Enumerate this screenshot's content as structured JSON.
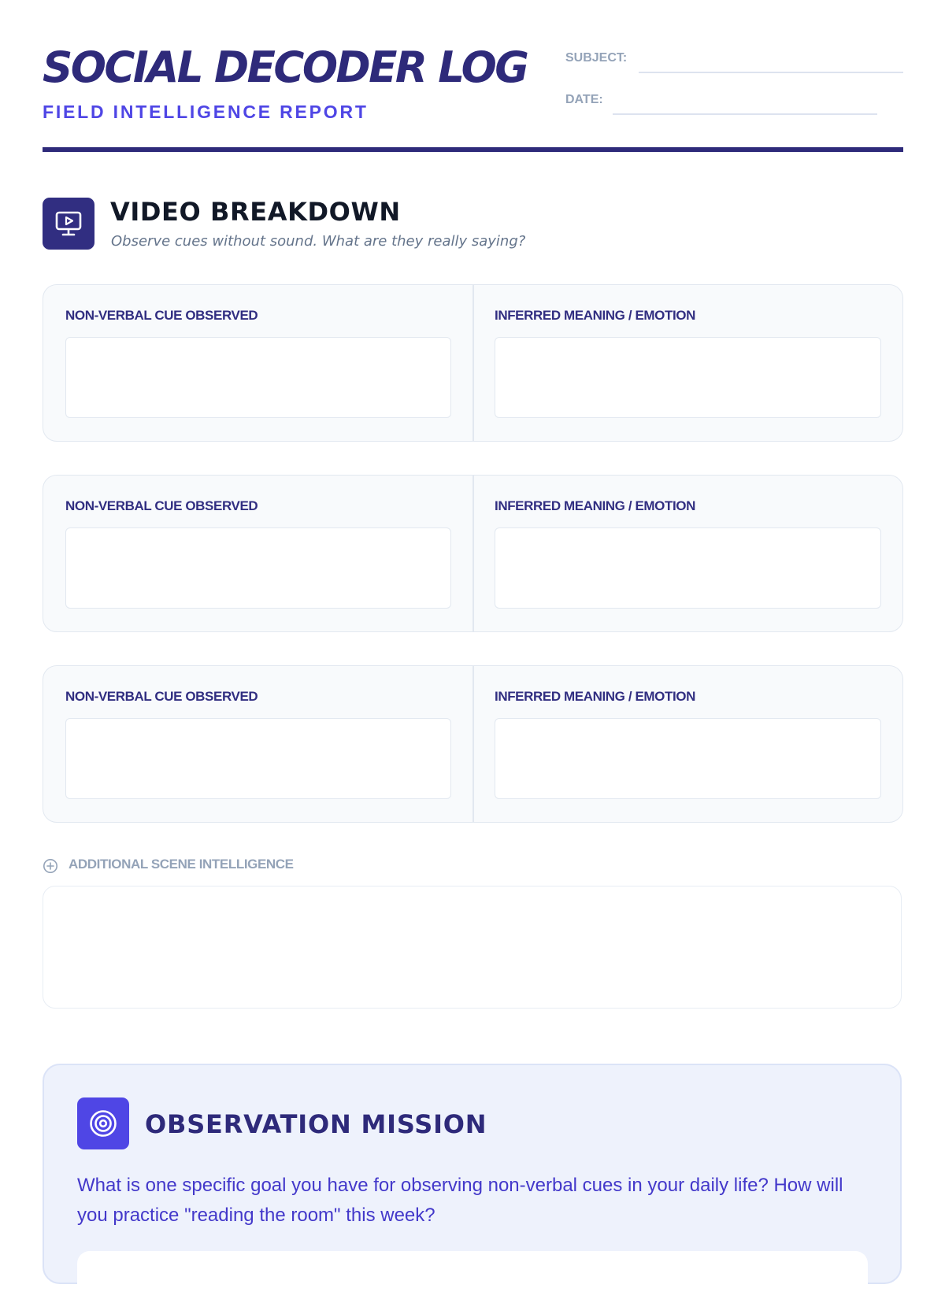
{
  "header": {
    "title": "SOCIAL DECODER LOG",
    "subtitle": "FIELD INTELLIGENCE REPORT",
    "subject_label": "SUBJECT:",
    "subject_value": "",
    "date_label": "DATE:",
    "date_value": ""
  },
  "video_breakdown": {
    "icon": "monitor-play-icon",
    "title": "VIDEO BREAKDOWN",
    "description": "Observe cues without sound. What are they really saying?",
    "entries": [
      {
        "cue_label": "NON-VERBAL CUE OBSERVED",
        "cue_value": "",
        "meaning_label": "INFERRED MEANING / EMOTION",
        "meaning_value": ""
      },
      {
        "cue_label": "NON-VERBAL CUE OBSERVED",
        "cue_value": "",
        "meaning_label": "INFERRED MEANING / EMOTION",
        "meaning_value": ""
      },
      {
        "cue_label": "NON-VERBAL CUE OBSERVED",
        "cue_value": "",
        "meaning_label": "INFERRED MEANING / EMOTION",
        "meaning_value": ""
      }
    ],
    "additional": {
      "icon": "plus-circle-icon",
      "label": "ADDITIONAL SCENE INTELLIGENCE",
      "value": ""
    }
  },
  "observation_mission": {
    "icon": "target-icon",
    "title": "OBSERVATION MISSION",
    "prompt": "What is one specific goal you have for observing non-verbal cues in your daily life? How will you practice \"reading the room\" this week?",
    "answer": ""
  },
  "colors": {
    "primary_dark": "#2e2a7a",
    "accent": "#4f46e5",
    "muted": "#94a3b8",
    "card_background": "#f8fafc",
    "mission_background": "#eef2fc"
  }
}
